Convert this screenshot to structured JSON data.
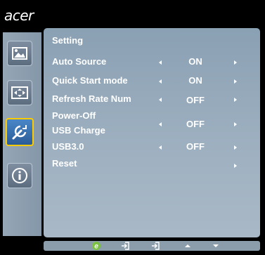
{
  "brand": "acer",
  "colors": {
    "panel": "#9fb1c1",
    "selected_tab": "#2a5c97",
    "selection_border": "#ffcc00",
    "text": "#ffffff"
  },
  "sidebar": {
    "tabs": [
      {
        "icon": "picture-icon",
        "selected": false
      },
      {
        "icon": "display-position-icon",
        "selected": false
      },
      {
        "icon": "wrench-settings-icon",
        "selected": true
      },
      {
        "icon": "info-icon",
        "selected": false
      }
    ]
  },
  "menu": {
    "title": "Setting",
    "items": [
      {
        "label": "Auto Source",
        "value": "ON"
      },
      {
        "label": "Quick Start mode",
        "value": "ON"
      },
      {
        "label": "Refresh Rate Num",
        "value": "OFF"
      },
      {
        "label": "Power-Off\nUSB Charge",
        "label_line1": "Power-Off",
        "label_line2": "USB Charge",
        "value": "OFF"
      },
      {
        "label": "USB3.0",
        "value": "OFF"
      },
      {
        "label": "Reset",
        "value": ""
      }
    ]
  },
  "footer": {
    "buttons": [
      "e-key-icon",
      "input-icon",
      "input-icon",
      "up-arrow-icon",
      "down-arrow-icon"
    ]
  }
}
